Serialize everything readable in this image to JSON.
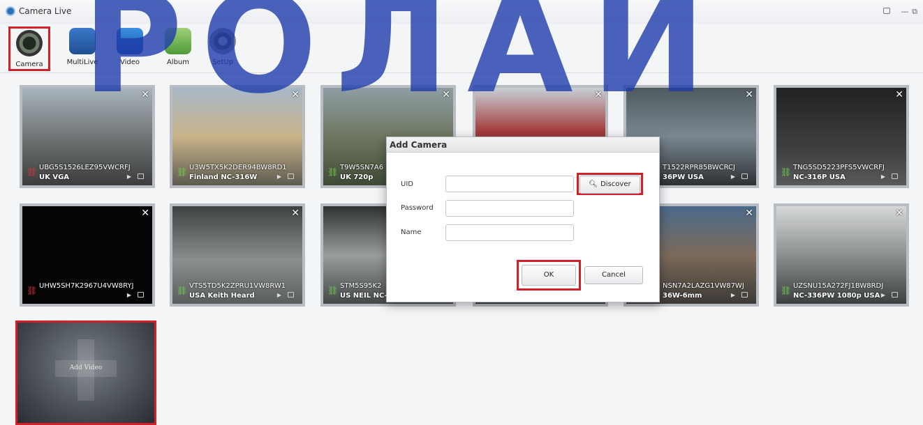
{
  "window": {
    "title": "Camera Live"
  },
  "watermark": {
    "text": "РОЛАИ"
  },
  "toolbar": {
    "items": [
      {
        "label": "Camera",
        "icon": "camera-icon",
        "selected": true
      },
      {
        "label": "MultiLive",
        "icon": "multilive-icon",
        "selected": false
      },
      {
        "label": "Video",
        "icon": "video-icon",
        "selected": false
      },
      {
        "label": "Album",
        "icon": "album-icon",
        "selected": false
      },
      {
        "label": "SetUp",
        "icon": "setup-gear-icon",
        "selected": false
      }
    ]
  },
  "cameras": [
    {
      "uid": "UBG5S1526LEZ95VWCRFJ",
      "name": "UK VGA",
      "status": "disconnected"
    },
    {
      "uid": "U3W5TX5K2DER94BW8RD1",
      "name": "Finland NC-316W",
      "status": "connected"
    },
    {
      "uid": "T9W5SN7A6",
      "name": "UK 720p",
      "status": "connected"
    },
    {
      "uid": "",
      "name": "",
      "status": "connected"
    },
    {
      "uid": "T1522RPR85BWCRCJ",
      "name": "36PW USA",
      "status": "connected"
    },
    {
      "uid": "TNG5SD5223PFS5VWCRFJ",
      "name": "NC-316P USA",
      "status": "connected"
    },
    {
      "uid": "UHW5SH7K2967U4VW8RYJ",
      "name": "",
      "status": "disconnected"
    },
    {
      "uid": "VTS5TD5K2ZPRU1VW8RW1",
      "name": "USA Keith Heard",
      "status": "connected"
    },
    {
      "uid": "STM5S95K2",
      "name": "US NEIL NC-",
      "status": "connected"
    },
    {
      "uid": "",
      "name": "",
      "status": "connected"
    },
    {
      "uid": "NSN7A2LAZG1VW87WJ",
      "name": "36W-6mm",
      "status": "connected"
    },
    {
      "uid": "UZSNU15A272FJ1BW8RDJ",
      "name": "NC-336PW 1080p USA",
      "status": "connected"
    }
  ],
  "add_tile": {
    "label": "Add Video"
  },
  "dialog": {
    "title": "Add Camera",
    "uid_label": "UID",
    "password_label": "Password",
    "name_label": "Name",
    "uid_value": "",
    "password_value": "",
    "name_value": "",
    "discover_label": "Discover",
    "ok_label": "OK",
    "cancel_label": "Cancel"
  },
  "colors": {
    "highlight_red": "#d0202a",
    "watermark_blue": "#1e3caa",
    "connected_green": "#6ed34a",
    "disconnected_red": "#e2323a"
  }
}
